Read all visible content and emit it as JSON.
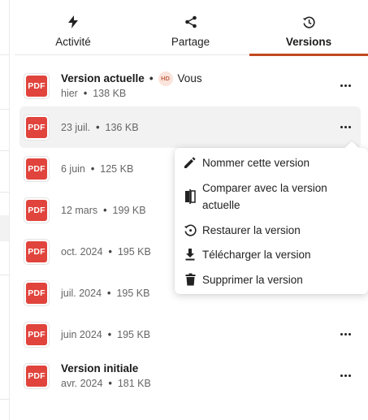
{
  "tabs": [
    {
      "label": "Activité",
      "icon": "lightning-icon",
      "active": false
    },
    {
      "label": "Partage",
      "icon": "share-icon",
      "active": false
    },
    {
      "label": "Versions",
      "icon": "history-icon",
      "active": true
    }
  ],
  "versions": [
    {
      "file_type": "PDF",
      "title": "Version actuelle",
      "badge": "HD",
      "author": "Vous",
      "date": "hier",
      "size": "138 KB",
      "more_icon": "more-horizontal-icon"
    },
    {
      "file_type": "PDF",
      "date": "23 juil.",
      "size": "136 KB",
      "highlighted": true,
      "more_icon": "more-horizontal-icon"
    },
    {
      "file_type": "PDF",
      "date": "6 juin",
      "size": "125 KB"
    },
    {
      "file_type": "PDF",
      "date": "12 mars",
      "size": "199 KB"
    },
    {
      "file_type": "PDF",
      "date": "oct. 2024",
      "size": "195 KB"
    },
    {
      "file_type": "PDF",
      "date": "juil. 2024",
      "size": "195 KB"
    },
    {
      "file_type": "PDF",
      "date": "juin 2024",
      "size": "195 KB",
      "more_icon": "more-horizontal-icon"
    },
    {
      "file_type": "PDF",
      "title": "Version initiale",
      "date": "avr. 2024",
      "size": "181 KB",
      "more_icon": "more-horizontal-icon"
    }
  ],
  "context_menu": {
    "items": [
      {
        "label": "Nommer cette version",
        "icon": "pencil-icon"
      },
      {
        "label": "Comparer avec la version actuelle",
        "icon": "compare-icon"
      },
      {
        "label": "Restaurer la version",
        "icon": "restore-icon"
      },
      {
        "label": "Télécharger la version",
        "icon": "download-icon"
      },
      {
        "label": "Supprimer la version",
        "icon": "trash-icon"
      }
    ]
  },
  "colors": {
    "accent": "#c24a1f",
    "pdf_badge": "#e0443c",
    "hd_badge_bg": "#fbe4dc",
    "hover_row": "#f2f2f2"
  }
}
